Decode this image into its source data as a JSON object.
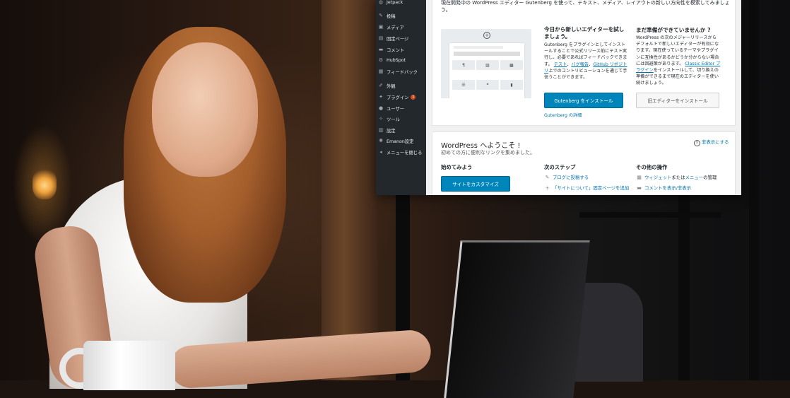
{
  "sidebar": {
    "items": [
      {
        "icon": "jetpack-icon",
        "glyph": "◍",
        "label": "Jetpack"
      },
      {
        "icon": "pin-icon",
        "glyph": "✎",
        "label": "投稿"
      },
      {
        "icon": "media-icon",
        "glyph": "▣",
        "label": "メディア"
      },
      {
        "icon": "page-icon",
        "glyph": "▤",
        "label": "固定ページ"
      },
      {
        "icon": "comment-icon",
        "glyph": "▬",
        "label": "コメント"
      },
      {
        "icon": "hubspot-icon",
        "glyph": "⚙",
        "label": "HubSpot"
      },
      {
        "icon": "feedback-icon",
        "glyph": "▦",
        "label": "フィードバック"
      },
      {
        "icon": "appearance-icon",
        "glyph": "✐",
        "label": "外観"
      },
      {
        "icon": "plugin-icon",
        "glyph": "✦",
        "label": "プラグイン",
        "badge": "1"
      },
      {
        "icon": "users-icon",
        "glyph": "●",
        "label": "ユーザー"
      },
      {
        "icon": "tools-icon",
        "glyph": "✧",
        "label": "ツール"
      },
      {
        "icon": "settings-icon",
        "glyph": "▥",
        "label": "設定"
      },
      {
        "icon": "emanon-settings-icon",
        "glyph": "✺",
        "label": "Emanon設定"
      },
      {
        "icon": "collapse-menu-icon",
        "glyph": "◂",
        "label": "メニューを閉じる"
      }
    ]
  },
  "gutenberg": {
    "intro": "現在開発中の WordPress エディター Gutenberg を使って、テキスト、メディア、レイアウトの新しい方向性を模索してみましょう。",
    "try_title": "今日から新しいエディターを試しましょう。",
    "try_text_1": "Gutenberg をプラグインとしてインストールすることで公式リリース前にテスト実行し、必要であればフィードバックできます。",
    "link_test": "テスト",
    "link_bug": "バグ報告",
    "link_github": "GitHub リポジトリ",
    "try_text_2": "上でのコントリビューションを通じて手伝うことができます。",
    "install_button": "Gutenberg をインストール",
    "details_link": "Gutenberg の詳細",
    "ready_title": "まだ準備ができていませんか ?",
    "ready_text_1": "WordPress の次のメジャーリリースからデフォルトで新しいエディターが有効になります。現在使っているテーマやプラグインに互換性があるかどうか分からない場合には回避策があります。",
    "classic_link": "Classic Editor プラグイン",
    "ready_text_2": "をインストールして、切り換えの準備ができるまで現在のエディターを使い続けましょう。",
    "classic_button": "旧エディターをインストール"
  },
  "welcome": {
    "title": "WordPress へようこそ !",
    "subtitle": "初めての方に便利なリンクを集めました。",
    "dismiss": "非表示にする",
    "col1_title": "始めてみよう",
    "customize_button": "サイトをカスタマイズ",
    "col2_title": "次のステップ",
    "next_steps": [
      "ブログに投稿する",
      "「サイトについて」固定ページを追加"
    ],
    "col3_title": "その他の操作",
    "widgets_link": "ウィジェット",
    "or_text": "または",
    "menus_link": "メニュー",
    "manage_text": "の管理",
    "comments_link": "コメントを表示/非表示"
  }
}
